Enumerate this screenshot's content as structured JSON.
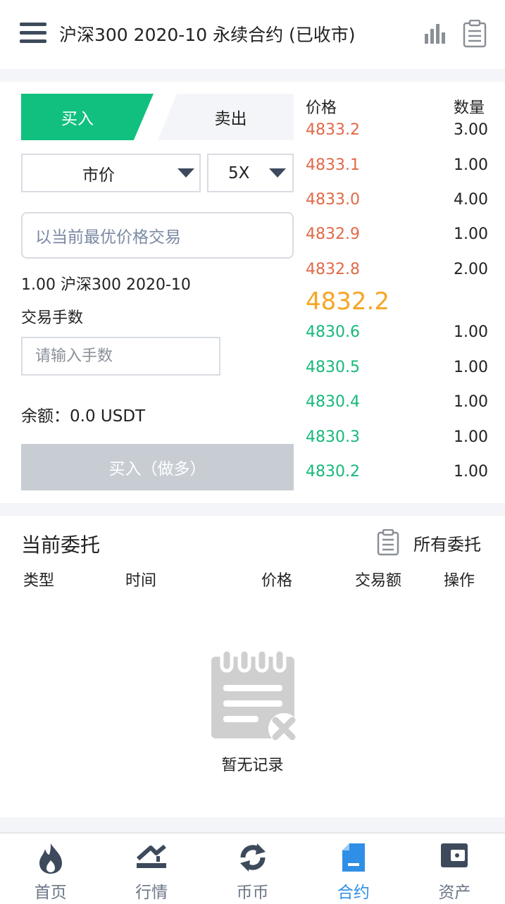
{
  "header": {
    "title": "沪深300 2020-10 永续合约 (已收市)",
    "chart_icon": "bar-chart-icon",
    "doc_icon": "clipboard-icon",
    "menu_icon": "hamburger-menu-icon"
  },
  "trade": {
    "tab_buy": "买入",
    "tab_sell": "卖出",
    "order_type": "市价",
    "leverage": "5X",
    "price_hint": "以当前最优价格交易",
    "contract_info": "1.00 沪深300 2020-10",
    "qty_label": "交易手数",
    "qty_placeholder": "请输入手数",
    "balance": "余额：0.0 USDT",
    "submit": "买入（做多）"
  },
  "orderbook": {
    "price_header": "价格",
    "qty_header": "数量",
    "asks": [
      {
        "price": "4833.2",
        "qty": "3.00"
      },
      {
        "price": "4833.1",
        "qty": "1.00"
      },
      {
        "price": "4833.0",
        "qty": "4.00"
      },
      {
        "price": "4832.9",
        "qty": "1.00"
      },
      {
        "price": "4832.8",
        "qty": "2.00"
      }
    ],
    "last": "4832.2",
    "bids": [
      {
        "price": "4830.6",
        "qty": "1.00"
      },
      {
        "price": "4830.5",
        "qty": "1.00"
      },
      {
        "price": "4830.4",
        "qty": "1.00"
      },
      {
        "price": "4830.3",
        "qty": "1.00"
      },
      {
        "price": "4830.2",
        "qty": "1.00"
      }
    ]
  },
  "orders": {
    "title": "当前委托",
    "all_label": "所有委托",
    "columns": [
      "类型",
      "时间",
      "价格",
      "交易额",
      "操作"
    ],
    "empty_text": "暂无记录"
  },
  "nav": {
    "items": [
      {
        "label": "首页",
        "icon": "flame-icon"
      },
      {
        "label": "行情",
        "icon": "market-trend-icon"
      },
      {
        "label": "币币",
        "icon": "exchange-arrows-icon"
      },
      {
        "label": "合约",
        "icon": "contract-doc-icon"
      },
      {
        "label": "资产",
        "icon": "wallet-icon"
      }
    ],
    "active": "合约"
  },
  "colors": {
    "buy_green": "#11c07e",
    "ask_red": "#e06a48",
    "bid_green": "#17b87a",
    "last_price_orange": "#f5a623",
    "nav_active_blue": "#2f8fe6"
  }
}
